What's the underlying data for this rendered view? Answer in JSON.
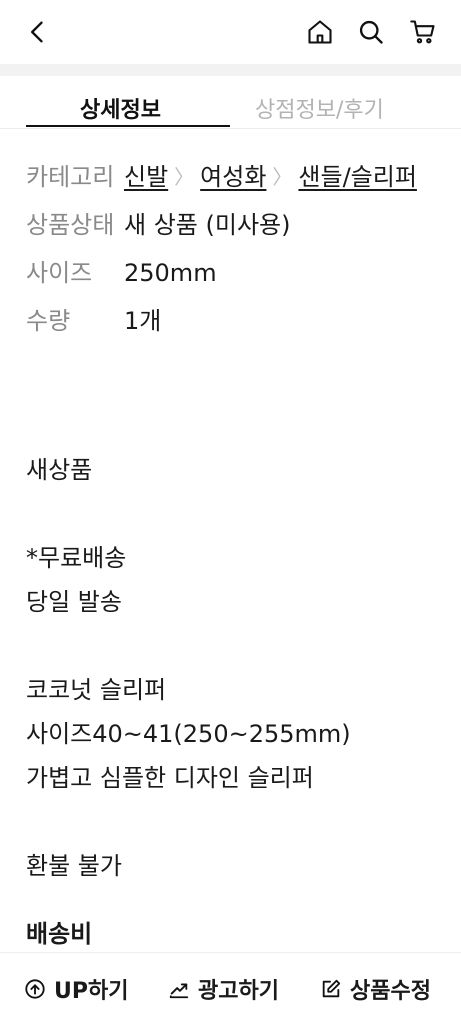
{
  "header": {
    "back_icon": "chevron-left-icon",
    "home_icon": "home-icon",
    "search_icon": "search-icon",
    "cart_icon": "cart-icon"
  },
  "tabs": [
    {
      "label": "상세정보",
      "active": true
    },
    {
      "label": "상점정보/후기",
      "active": false
    }
  ],
  "info": {
    "category_label": "카테고리",
    "category_path": [
      "신발",
      "여성화",
      "샌들/슬리퍼"
    ],
    "condition_label": "상품상태",
    "condition_value": "새 상품 (미사용)",
    "size_label": "사이즈",
    "size_value": "250mm",
    "quantity_label": "수량",
    "quantity_value": "1개"
  },
  "description": {
    "lines": [
      "새상품",
      "",
      "*무료배송",
      "당일 발송",
      "",
      "코코넛 슬리퍼",
      "사이즈40~41(250~255mm)",
      "가볍고 심플한 디자인 슬리퍼",
      "",
      "환불 불가"
    ],
    "shipping_heading": "배송비"
  },
  "bottom_bar": {
    "up_label": "UP하기",
    "ad_label": "광고하기",
    "edit_label": "상품수정"
  }
}
